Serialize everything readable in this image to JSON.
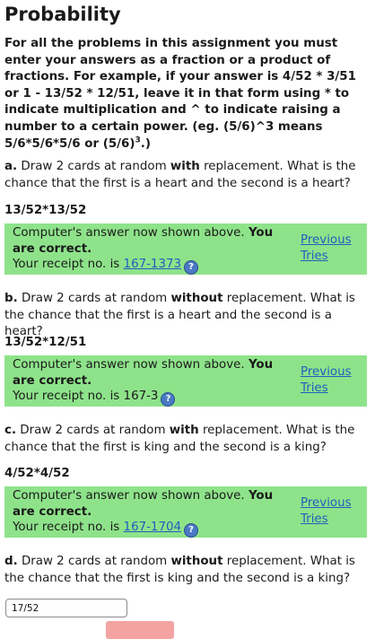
{
  "page_title": "Probability",
  "instructions": {
    "line1": "For all the problems in this assignment you must enter your answers as a fraction or a product of fractions. For example, if your answer is 4/52 * 3/51 or 1 - 13/52 * 12/51, leave it in that form using * to indicate multiplication and ^ to indicate raising a number to a certain power. (eg. (5/6)^3 means 5/6*5/6*5/6 or",
    "example_base": "(5/6)",
    "example_exp": "3",
    "example_end": ".)"
  },
  "problems": [
    {
      "letter": "a.",
      "text_before": "Draw 2 cards at random",
      "emphasis": "with",
      "text_after": "replacement. What is the chance that the first is a heart and the second is a heart?",
      "answer": "13/52*13/52",
      "feedback_msg": "Computer's answer now shown above.",
      "feedback_status": "You are correct.",
      "receipt_label": "Your receipt no. is",
      "receipt_no": "167-1373",
      "receipt_linked": true,
      "prev_tries": "Previous Tries"
    },
    {
      "letter": "b.",
      "text_before": "Draw 2 cards at random",
      "emphasis": "without",
      "text_after": "replacement. What is the chance that the first is a heart and the second is a heart?",
      "answer": "13/52*12/51",
      "feedback_msg": "Computer's answer now shown above.",
      "feedback_status": "You are correct.",
      "receipt_label": "Your receipt no. is",
      "receipt_no": "167-3",
      "receipt_linked": false,
      "prev_tries": "Previous Tries"
    },
    {
      "letter": "c.",
      "text_before": "Draw 2 cards at random",
      "emphasis": "with",
      "text_after": "replacement. What is the chance that the first is king and the second is a king?",
      "answer": "4/52*4/52",
      "feedback_msg": "Computer's answer now shown above.",
      "feedback_status": "You are correct.",
      "receipt_label": "Your receipt no. is",
      "receipt_no": "167-1704",
      "receipt_linked": true,
      "prev_tries": "Previous Tries"
    },
    {
      "letter": "d.",
      "text_before": "Draw 2 cards at random",
      "emphasis": "without",
      "text_after": "replacement. What is the chance that the first is king and the second is a king?"
    }
  ],
  "answer_input": {
    "value": "17/52"
  },
  "help_icon_glyph": "?",
  "colors": {
    "feedback_bg": "#8ee38a",
    "link": "#1f5fbf",
    "help_icon": "#4a79c4",
    "submit_button": "#f4a3a3"
  }
}
